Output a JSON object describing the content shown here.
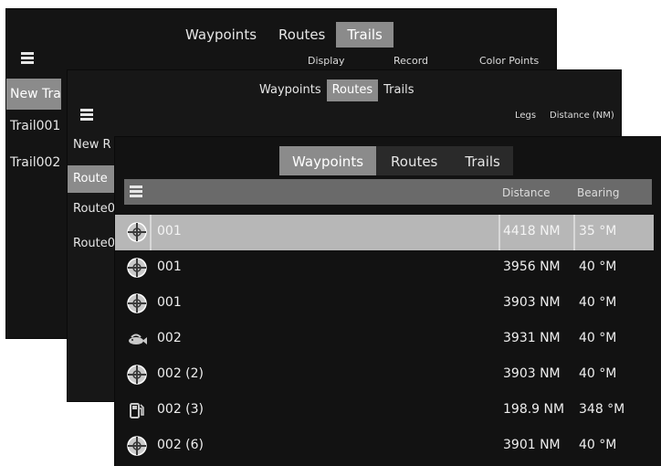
{
  "trails_panel": {
    "tabs": [
      "Waypoints",
      "Routes",
      "Trails"
    ],
    "active_tab": 2,
    "columns": [
      "Display",
      "Record",
      "Color Points"
    ],
    "items": [
      "New Tra",
      "Trail001",
      "Trail002"
    ]
  },
  "routes_panel": {
    "tabs": [
      "Waypoints",
      "Routes",
      "Trails"
    ],
    "active_tab": 1,
    "columns": [
      "Legs",
      "Distance (NM)"
    ],
    "items": [
      "New R",
      "Route",
      "Route0",
      "Route0"
    ]
  },
  "waypoints_panel": {
    "tabs": [
      "Waypoints",
      "Routes",
      "Trails"
    ],
    "active_tab": 0,
    "columns": [
      "Distance",
      "Bearing"
    ],
    "rows": [
      {
        "icon": "waypoint-icon",
        "name": "001",
        "distance": "4418 NM",
        "bearing": "35 °M",
        "selected": true
      },
      {
        "icon": "waypoint-icon",
        "name": "001",
        "distance": "3956 NM",
        "bearing": "40 °M"
      },
      {
        "icon": "waypoint-icon",
        "name": "001",
        "distance": "3903 NM",
        "bearing": "40 °M"
      },
      {
        "icon": "fish-icon",
        "name": "002",
        "distance": "3931 NM",
        "bearing": "40 °M"
      },
      {
        "icon": "waypoint-icon",
        "name": "002 (2)",
        "distance": "3903 NM",
        "bearing": "40 °M"
      },
      {
        "icon": "fuel-icon",
        "name": "002 (3)",
        "distance": "198.9 NM",
        "bearing": "348 °M"
      },
      {
        "icon": "waypoint-icon",
        "name": "002 (6)",
        "distance": "3901 NM",
        "bearing": "40 °M"
      }
    ]
  },
  "colors": {
    "panel_bg": "#141414",
    "tab_active": "#8b8b8b",
    "header_bar": "#6a6a6a",
    "row_selected": "#b7b7b7",
    "text": "#e8e8e8"
  }
}
